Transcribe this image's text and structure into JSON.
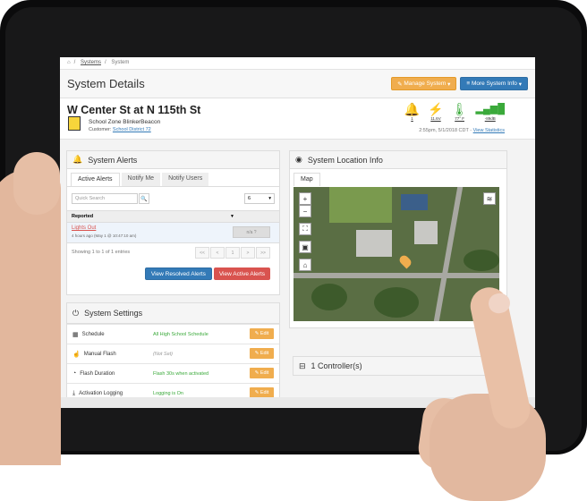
{
  "breadcrumb": {
    "home_icon": "home-icon",
    "systems": "Systems",
    "current": "System"
  },
  "page_title": "System Details",
  "buttons": {
    "manage_system": "Manage System",
    "more_system_info": "More System Info"
  },
  "system": {
    "name": "W Center St at N 115th St",
    "type": "School Zone BlinkerBeacon",
    "customer_label": "Customer:",
    "customer": "School District 72",
    "status": {
      "alerts": "1",
      "voltage": "11.6V",
      "temperature": "77° F",
      "signal": "-89dB"
    },
    "updated": "2:55pm, 5/1/2018 CDT -",
    "view_statistics": "View Statistics"
  },
  "alerts_panel": {
    "title": "System Alerts",
    "tabs": [
      "Active Alerts",
      "Notify Me",
      "Notify Users"
    ],
    "search_placeholder": "Quick Search",
    "page_size": "6",
    "column": "Reported",
    "rows": [
      {
        "title": "Lights Out",
        "time": "4 hours ago (May 1 @ 10:47:10 am)",
        "action": "n/a"
      }
    ],
    "showing": "Showing 1 to 1 of 1 entries",
    "pager": [
      "<<",
      "<",
      "1",
      ">",
      ">>"
    ],
    "view_resolved": "View Resolved Alerts",
    "view_active": "View Active Alerts"
  },
  "settings_panel": {
    "title": "System Settings",
    "rows": [
      {
        "label": "Schedule",
        "value": "All High School Schedule",
        "edit": "Edit"
      },
      {
        "label": "Manual Flash",
        "value": "(Not Set)",
        "edit": "Edit"
      },
      {
        "label": "Flash Duration",
        "value": "Flash 30s when activated",
        "edit": "Edit"
      },
      {
        "label": "Activation Logging",
        "value": "Logging is On",
        "edit": "Edit"
      }
    ]
  },
  "location_panel": {
    "title": "System Location Info",
    "tab": "Map"
  },
  "controllers": {
    "label": "1 Controller(s)"
  },
  "colors": {
    "orange": "#f0ad4e",
    "blue": "#337ab7",
    "red": "#d9534f",
    "green": "#3aa93a"
  }
}
